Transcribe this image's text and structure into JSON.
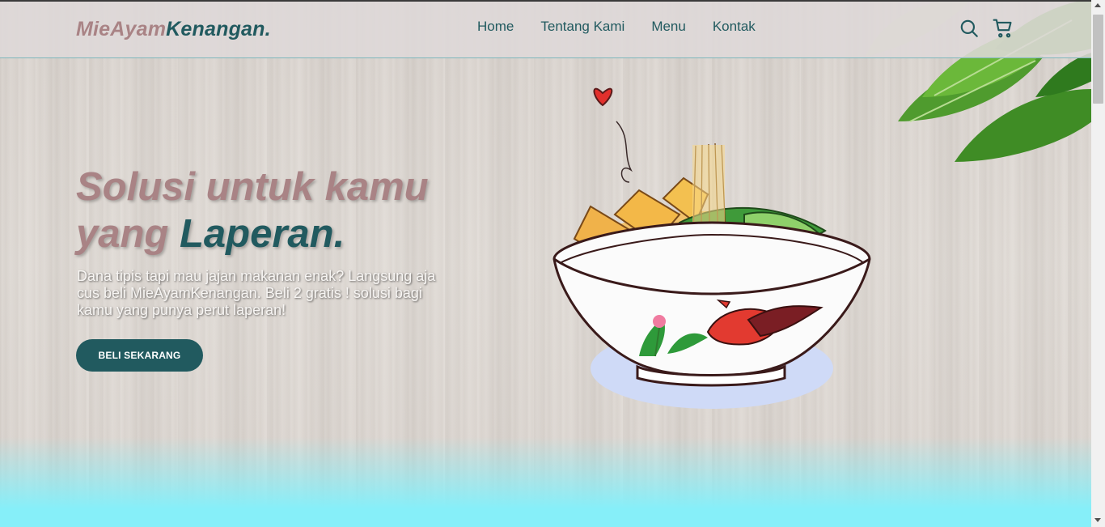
{
  "brand": {
    "part1": "MieAyam",
    "part2": "Kenangan",
    "dot": "."
  },
  "nav": {
    "items": [
      "Home",
      "Tentang Kami",
      "Menu",
      "Kontak"
    ]
  },
  "icons": {
    "search": "search-icon",
    "cart": "shopping-cart-icon"
  },
  "hero": {
    "title_line1": "Solusi untuk kamu",
    "title_line2_start": "yang",
    "title_line2_accent": "Laperan.",
    "description": "Dana tipis tapi mau jajan makanan enak? Langsung aja cus beli MieAyamKenangan. Beli 2 gratis ! solusi bagi kamu yang punya perut laperan!",
    "cta_label": "BELI SEKARANG"
  },
  "colors": {
    "accent": "#215a5f",
    "brand_pink": "#a98385",
    "footer_cyan": "#86eff9"
  }
}
